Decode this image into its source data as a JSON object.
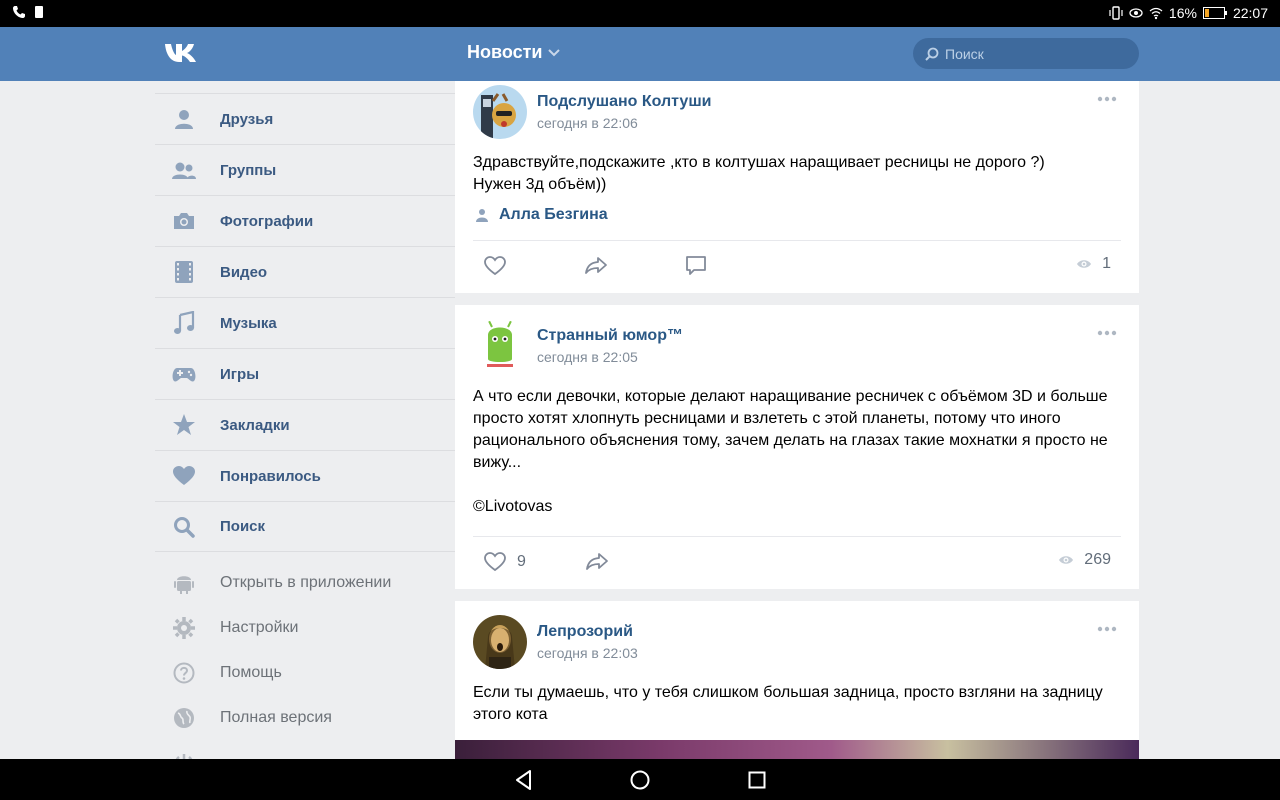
{
  "status_bar": {
    "battery": "16%",
    "time": "22:07"
  },
  "header": {
    "title": "Новости",
    "search_placeholder": "Поиск"
  },
  "sidebar": {
    "items": [
      {
        "label": "Друзья",
        "icon": "person-icon"
      },
      {
        "label": "Группы",
        "icon": "group-icon"
      },
      {
        "label": "Фотографии",
        "icon": "camera-icon"
      },
      {
        "label": "Видео",
        "icon": "film-icon"
      },
      {
        "label": "Музыка",
        "icon": "music-note-icon"
      },
      {
        "label": "Игры",
        "icon": "gamepad-icon"
      },
      {
        "label": "Закладки",
        "icon": "star-icon"
      },
      {
        "label": "Понравилось",
        "icon": "heart-icon"
      },
      {
        "label": "Поиск",
        "icon": "search-icon"
      }
    ],
    "sub_items": [
      {
        "label": "Открыть в приложении",
        "icon": "android-icon"
      },
      {
        "label": "Настройки",
        "icon": "gear-icon"
      },
      {
        "label": "Помощь",
        "icon": "help-icon"
      },
      {
        "label": "Полная версия",
        "icon": "globe-icon"
      }
    ],
    "accent_color": "#3b5a82",
    "icon_color": "#8fa3bc"
  },
  "feed": {
    "posts": [
      {
        "name": "Подслушано Колтуши",
        "time": "сегодня в 22:06",
        "text": "Здравствуйте,подскажите ,кто в колтушах наращивает ресницы не дорого ?)\nНужен 3д объём))",
        "author": "Алла Безгина",
        "views": "1"
      },
      {
        "name": "Странный юмор™",
        "time": "сегодня в 22:05",
        "text": "А что если девочки, которые делают наращивание ресничек с объёмом 3D и больше просто хотят хлопнуть ресницами и взлететь с этой планеты, потому что иного рационального объяснения тому, зачем делать на глазах такие мохнатки я просто не вижу...\n\n©Livotovas",
        "likes": "9",
        "views": "269"
      },
      {
        "name": "Лепрозорий",
        "time": "сегодня в 22:03",
        "text": "Если ты думаешь, что у тебя слишком большая задница, просто взгляни на задницу этого кота"
      }
    ]
  },
  "colors": {
    "header_bg": "#5181b8",
    "link": "#2a5885",
    "meta": "#818c99"
  }
}
